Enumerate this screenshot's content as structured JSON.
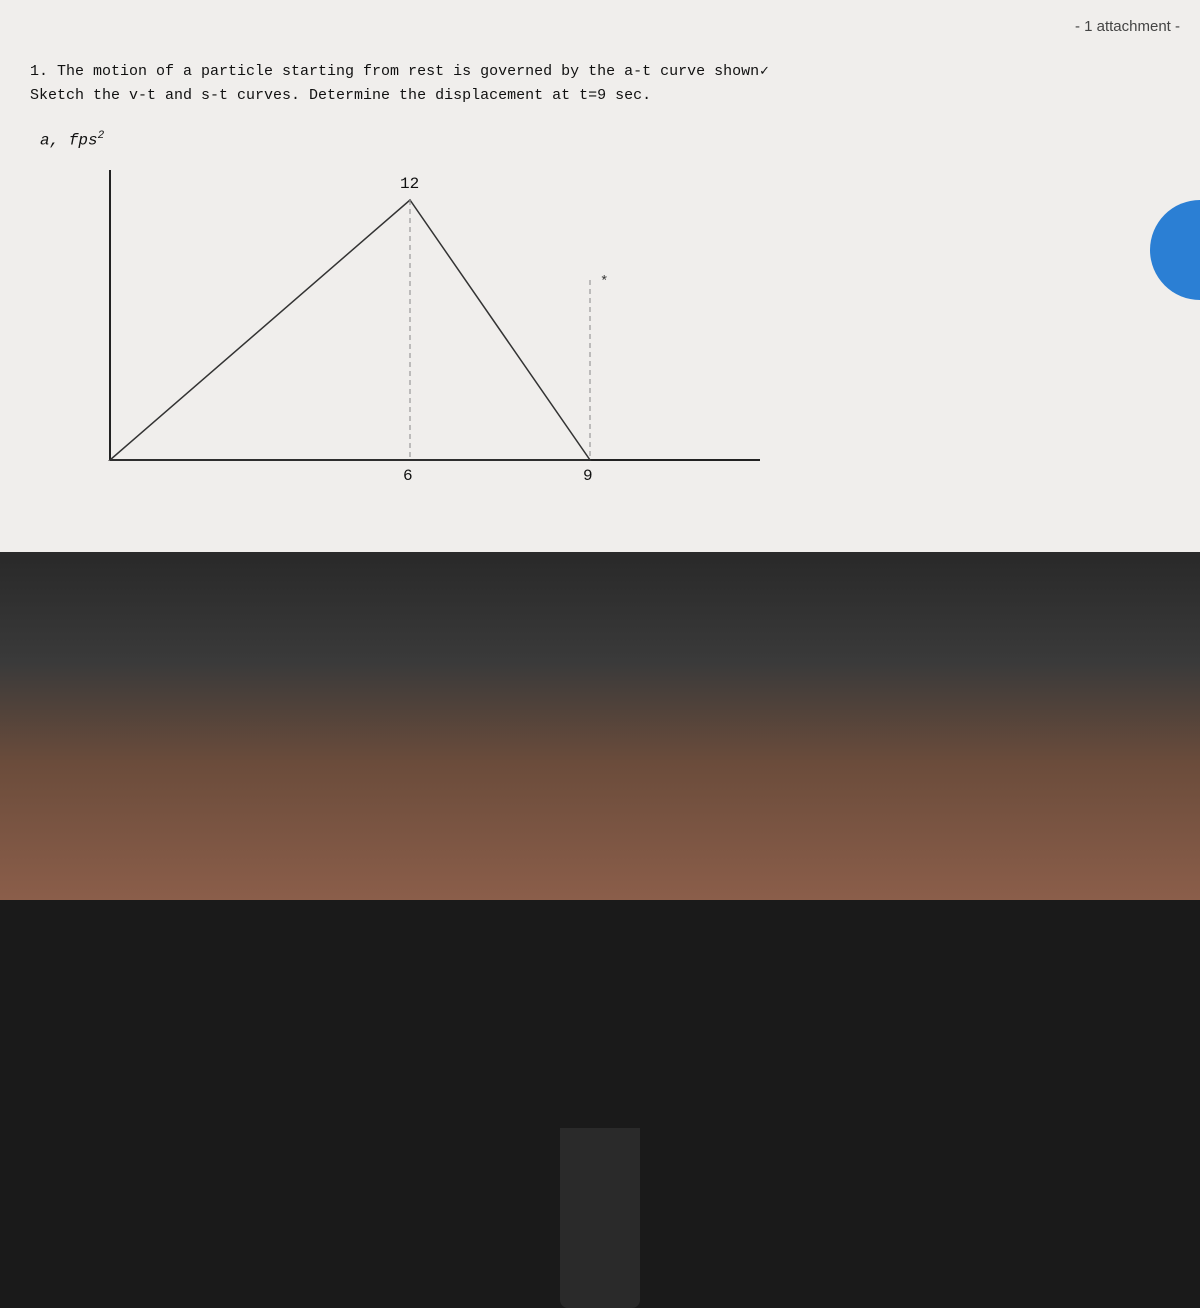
{
  "header": {
    "attachment_label": "- 1 attachment -"
  },
  "problem": {
    "line1": "1. The motion of  a particle starting from rest is governed by the a-t curve shown",
    "line2": "   Sketch the v-t and s-t curves. Determine the displacement at t=9 sec.",
    "chevron": "✓"
  },
  "graph": {
    "y_axis_label": "a, fps²",
    "peak_label": "12",
    "x_label_6": "6",
    "x_label_9": "9",
    "star_marker": "*"
  }
}
